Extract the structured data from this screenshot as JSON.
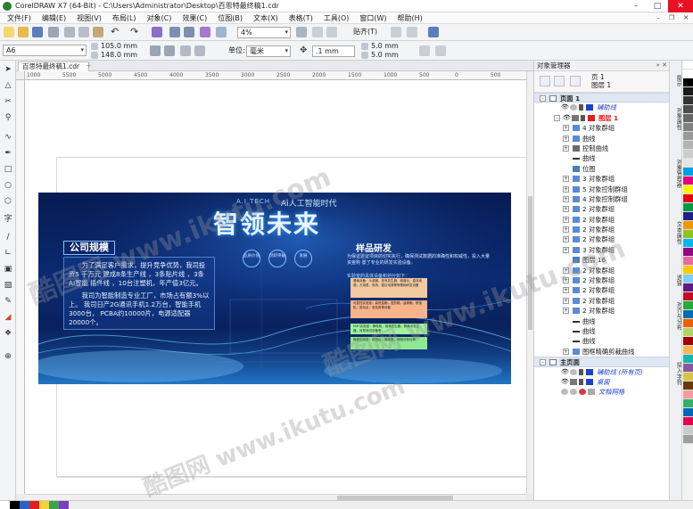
{
  "window": {
    "title": "CorelDRAW X7 (64-Bit) - C:\\Users\\Administrator\\Desktop\\百思特最终稿1.cdr"
  },
  "menu": [
    "文件(F)",
    "编辑(E)",
    "视图(V)",
    "布局(L)",
    "对象(C)",
    "效果(C)",
    "位图(B)",
    "文本(X)",
    "表格(T)",
    "工具(O)",
    "窗口(W)",
    "帮助(H)"
  ],
  "toolbar": {
    "zoom_value": "4%",
    "snap_label": "贴齐(T)"
  },
  "propbar": {
    "page_size": "A6",
    "width": "105.0 mm",
    "height": "148.0 mm",
    "unit_label": "单位:",
    "unit_value": "毫米",
    "nudge": ".1 mm",
    "dup_x": "5.0 mm",
    "dup_y": "5.0 mm"
  },
  "document": {
    "tab_name": "百思特最终稿1.cdr",
    "add_tab": "+"
  },
  "ruler": {
    "ticks": [
      "1000",
      "5500",
      "5000",
      "4500",
      "4000",
      "3500",
      "3000",
      "2500",
      "2000",
      "1500",
      "1000",
      "500",
      "0",
      "500"
    ]
  },
  "banner": {
    "tech_label": "A.I TECH",
    "ai_era": "Ai人工智能时代",
    "main_title": "智领未来",
    "circles": [
      "品质价值",
      "创新突破",
      "发展"
    ],
    "company_scale": {
      "title": "公司规模",
      "para1": "为了满足客户需求，提升竞争优势，我司投资5 千万元 建成8条生产线 ，3条贴片线 ，3条AI智能 插件线 ，10台注塑机，年产值3亿元。",
      "para2": "我司为智能制造专业工厂，市场占有额3%以上。 我司日产2G通讯手机1.2万台，智能手机3000台， PCBA约10000片，电源适配器20000个。"
    },
    "sample_dev": {
      "title": "样品研发",
      "desc": "为保证验证项目的切实执行，确保测试数据的准确性和权威性，投入大量资金购 置了专业的研发实验设备。",
      "sub": "实验室的具体设备和划分如下：",
      "boxes": [
        "基础设备：示波器，信号发生器，频谱仪，直流电源，万用表，电桥，稳压电源等等基础研发设备",
        "可靠性实验室：高低温箱，湿热箱，盐雾箱，跌落机，振动台，老化房等设备",
        "EMC实验室：静电枪，浪涌发生器，群脉冲发生器，传导测试设备等",
        "射频实验室：综测仪，屏蔽箱，网络分析仪等"
      ]
    }
  },
  "object_manager": {
    "title": "对象管理器",
    "page_label": "页 1",
    "layer_label": "图层 1",
    "page1": "页面 1",
    "guides": "辅助线",
    "layer1": "图层 1",
    "items": [
      "4 对象群组",
      "曲线",
      "控制曲线",
      "曲线",
      "位图",
      "3 对象群组",
      "5 对象控制群组",
      "4 对象控制群组",
      "2 对象群组",
      "2 对象群组",
      "2 对象群组",
      "2 对象群组",
      "3 对象群组",
      "图层 16",
      "2 对象群组",
      "2 对象群组",
      "2 对象群组",
      "2 对象群组",
      "2 对象群组",
      "曲线",
      "曲线",
      "曲线",
      "图框精确剪裁曲线"
    ],
    "master_page": "主页面",
    "master_guides": "辅助线 (所有页)",
    "desktop": "桌面",
    "doc_grid": "文档网格"
  },
  "side_tabs": [
    "提示",
    "对象属性",
    "对象管理器",
    "文本属性",
    "透镜",
    "对齐与分布",
    "插入字符"
  ],
  "watermark": "酷图网 www.ikutu.com",
  "colors": {
    "accent": "#1f5fb0",
    "layer_red": "#e0201c",
    "header_bg": "#dfe7f3"
  }
}
